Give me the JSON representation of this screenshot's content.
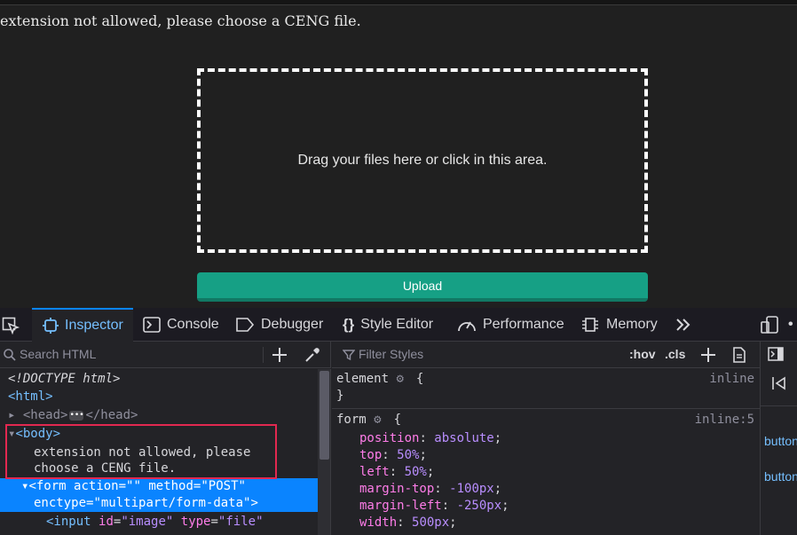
{
  "page": {
    "message": "extension not allowed, please choose a CENG file.",
    "dropzone_text": "Drag your files here or click in this area.",
    "upload_label": "Upload"
  },
  "devtools": {
    "tabs": [
      {
        "label": "Inspector",
        "icon": "inspector-icon",
        "active": true
      },
      {
        "label": "Console",
        "icon": "console-icon"
      },
      {
        "label": "Debugger",
        "icon": "debugger-icon"
      },
      {
        "label": "Style Editor",
        "icon": "style-editor-icon"
      },
      {
        "label": "Performance",
        "icon": "performance-icon"
      },
      {
        "label": "Memory",
        "icon": "memory-icon"
      }
    ],
    "search_placeholder": "Search HTML",
    "filter_placeholder": "Filter Styles",
    "hov_label": ":hov",
    "cls_label": ".cls",
    "markup": {
      "doctype": "<!DOCTYPE html>",
      "html_open": "<html>",
      "head_open": "<head>",
      "head_close": "</head>",
      "body_open": "<body>",
      "body_text_1": "extension not allowed, please",
      "body_text_2": "choose a CENG file.",
      "form_tag": "<form",
      "form_attr1": "action",
      "form_val1": "\"\"",
      "form_attr2": "method",
      "form_val2": "\"POST\"",
      "form_attr3": "enctype",
      "form_val3": "\"multipart/form-data\"",
      "form_end": ">",
      "input_tag": "<input",
      "input_attr1": "id",
      "input_val1": "\"image\"",
      "input_attr2": "type",
      "input_val2": "\"file\""
    },
    "rules": {
      "element_selector": "element",
      "element_source": "inline",
      "form_selector": "form",
      "form_source": "inline:5",
      "props": [
        {
          "name": "position",
          "value": "absolute"
        },
        {
          "name": "top",
          "value": "50%"
        },
        {
          "name": "left",
          "value": "50%"
        },
        {
          "name": "margin-top",
          "value": "-100px"
        },
        {
          "name": "margin-left",
          "value": "-250px"
        },
        {
          "name": "width",
          "value": "500px"
        }
      ]
    },
    "side_links": [
      "button",
      "button"
    ]
  }
}
